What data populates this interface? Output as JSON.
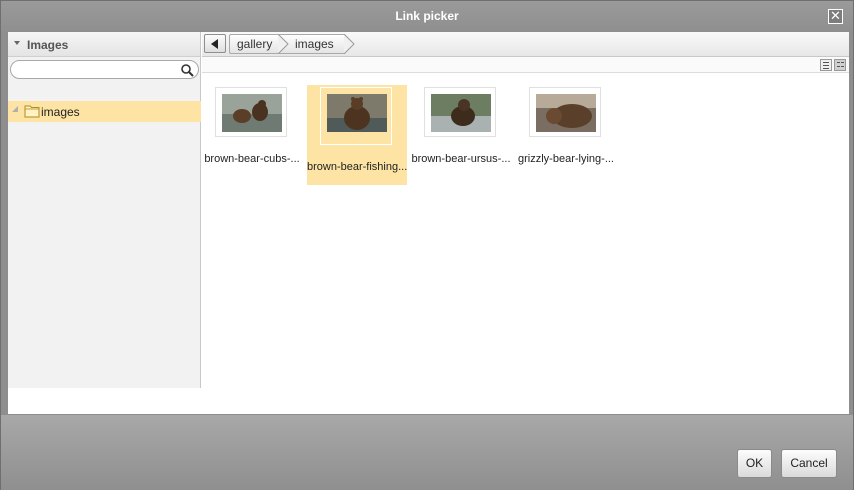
{
  "dialog": {
    "title": "Link picker",
    "close_icon": "close-icon"
  },
  "left_panel": {
    "title": "Images",
    "search": {
      "value": "",
      "placeholder": ""
    },
    "tree": [
      {
        "label": "images",
        "icon": "folder-icon",
        "selected": true
      }
    ]
  },
  "breadcrumb": {
    "back_icon": "back-arrow-icon",
    "items": [
      "gallery",
      "images"
    ]
  },
  "view_modes": [
    "list-view-icon",
    "thumbnail-view-icon"
  ],
  "files": [
    {
      "label": "brown-bear-cubs-...",
      "selected": false
    },
    {
      "label": "brown-bear-fishing...",
      "selected": true
    },
    {
      "label": "brown-bear-ursus-...",
      "selected": false
    },
    {
      "label": "grizzly-bear-lying-...",
      "selected": false
    }
  ],
  "footer": {
    "ok_label": "OK",
    "cancel_label": "Cancel"
  },
  "colors": {
    "selection": "#fde4a4",
    "chrome": "#8e8e8e"
  }
}
